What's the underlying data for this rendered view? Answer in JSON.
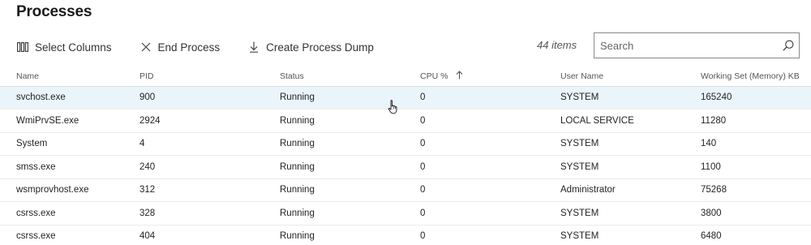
{
  "page": {
    "title": "Processes"
  },
  "toolbar": {
    "select_columns": {
      "label": "Select Columns",
      "icon": "columns-icon"
    },
    "end_process": {
      "label": "End Process",
      "icon": "close-icon"
    },
    "create_dump": {
      "label": "Create Process Dump",
      "icon": "download-icon"
    }
  },
  "item_count": "44 items",
  "search": {
    "placeholder": "Search",
    "value": ""
  },
  "table": {
    "columns": [
      "Name",
      "PID",
      "Status",
      "CPU %",
      "User Name",
      "Working Set (Memory) KB"
    ],
    "sort": {
      "column": "CPU %",
      "direction": "ascending"
    },
    "rows": [
      {
        "name": "svchost.exe",
        "pid": "900",
        "status": "Running",
        "cpu": "0",
        "user": "SYSTEM",
        "memory": "165240",
        "selected": true
      },
      {
        "name": "WmiPrvSE.exe",
        "pid": "2924",
        "status": "Running",
        "cpu": "0",
        "user": "LOCAL SERVICE",
        "memory": "11280"
      },
      {
        "name": "System",
        "pid": "4",
        "status": "Running",
        "cpu": "0",
        "user": "SYSTEM",
        "memory": "140"
      },
      {
        "name": "smss.exe",
        "pid": "240",
        "status": "Running",
        "cpu": "0",
        "user": "SYSTEM",
        "memory": "1100"
      },
      {
        "name": "wsmprovhost.exe",
        "pid": "312",
        "status": "Running",
        "cpu": "0",
        "user": "Administrator",
        "memory": "75268"
      },
      {
        "name": "csrss.exe",
        "pid": "328",
        "status": "Running",
        "cpu": "0",
        "user": "SYSTEM",
        "memory": "3800"
      },
      {
        "name": "csrss.exe",
        "pid": "404",
        "status": "Running",
        "cpu": "0",
        "user": "SYSTEM",
        "memory": "6480"
      }
    ]
  }
}
